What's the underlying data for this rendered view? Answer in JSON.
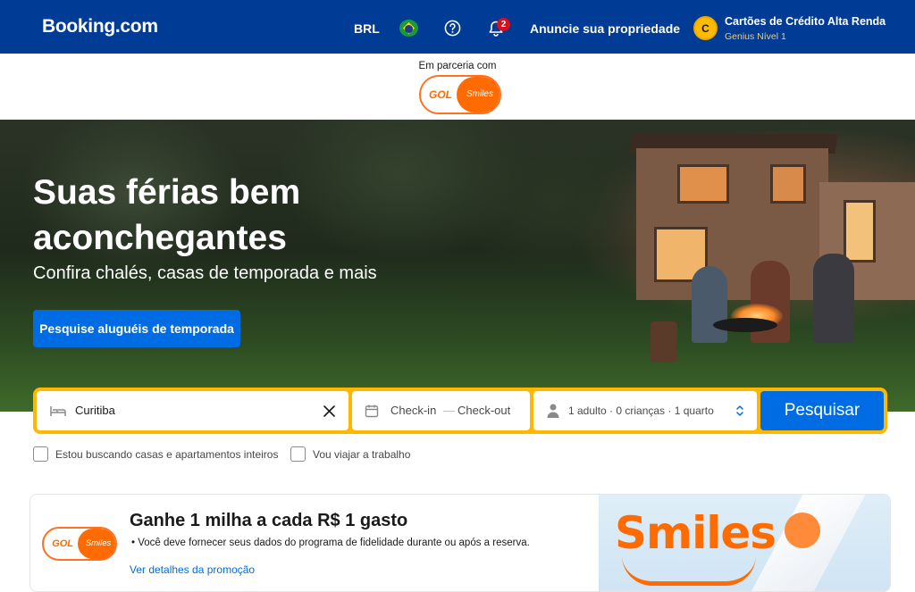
{
  "header": {
    "logo": "Booking.com",
    "currency": "BRL",
    "flag_icon": "brazil-flag-icon",
    "help_icon": "help-circle-icon",
    "notifications_icon": "bell-icon",
    "notifications_count": "2",
    "list_property": "Anuncie sua propriedade",
    "user": {
      "initial": "C",
      "name": "Cartões de Crédito Alta Renda",
      "level": "Genius Nível 1"
    }
  },
  "partner": {
    "label": "Em parceria com",
    "logo_left": "GOL",
    "logo_right": "Smiles"
  },
  "hero": {
    "title": "Suas férias bem aconchegantes",
    "subtitle": "Confira chalés, casas de temporada e mais",
    "cta": "Pesquise aluguéis de temporada"
  },
  "search": {
    "destination": "Curitiba",
    "checkin": "Check-in",
    "dash": "—",
    "checkout": "Check-out",
    "guests": "1 adulto · 0 crianças · 1 quarto",
    "button": "Pesquisar",
    "colors": {
      "frame": "#ffb700",
      "button": "#006ce4"
    }
  },
  "filters": {
    "entire_homes": "Estou buscando casas e apartamentos inteiros",
    "work_travel": "Vou viajar a trabalho"
  },
  "promo": {
    "logo_left": "GOL",
    "logo_right": "Smiles",
    "title": "Ganhe 1 milha a cada R$ 1 gasto",
    "bullet": "Você deve fornecer seus dados do programa de fidelidade durante ou após a reserva.",
    "link": "Ver detalhes da promoção",
    "art_brand": "Smiles"
  },
  "colors": {
    "brand_blue": "#003b95",
    "action_blue": "#006ce4",
    "smiles_orange": "#ff6b00",
    "genius_yellow": "#febb02"
  }
}
